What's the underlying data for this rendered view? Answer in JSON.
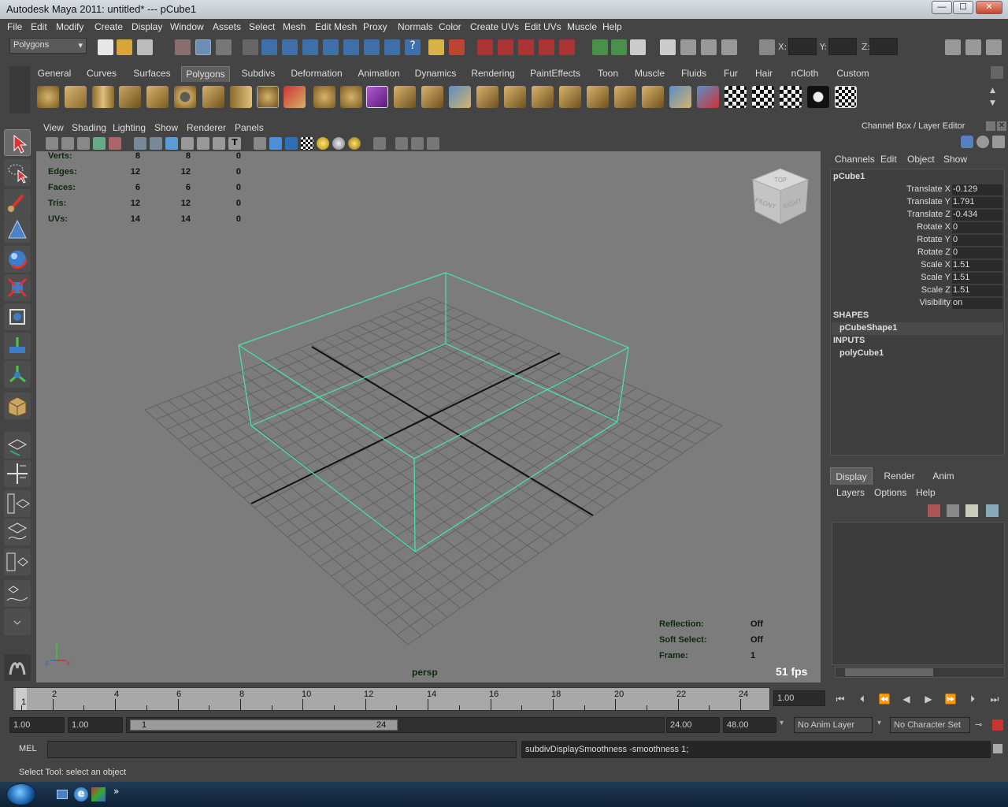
{
  "window": {
    "title": "Autodesk Maya 2011: untitled*  ---  pCube1",
    "min": "—",
    "max": "☐",
    "close": "✕"
  },
  "menubar": [
    "File",
    "Edit",
    "Modify",
    "Create",
    "Display",
    "Window",
    "Assets",
    "Select",
    "Mesh",
    "Edit Mesh",
    "Proxy",
    "Normals",
    "Color",
    "Create UVs",
    "Edit UVs",
    "Muscle",
    "Help"
  ],
  "statusline": {
    "menuset": "Polygons",
    "x_label": "X:",
    "y_label": "Y:",
    "z_label": "Z:"
  },
  "shelf": {
    "tabs": [
      "General",
      "Curves",
      "Surfaces",
      "Polygons",
      "Subdivs",
      "Deformation",
      "Animation",
      "Dynamics",
      "Rendering",
      "PaintEffects",
      "Toon",
      "Muscle",
      "Fluids",
      "Fur",
      "Hair",
      "nCloth",
      "Custom"
    ],
    "active_tab": "Polygons"
  },
  "viewport": {
    "menu": [
      "View",
      "Shading",
      "Lighting",
      "Show",
      "Renderer",
      "Panels"
    ],
    "hud": {
      "rows": [
        {
          "label": "Verts:",
          "a": "8",
          "b": "8",
          "c": "0"
        },
        {
          "label": "Edges:",
          "a": "12",
          "b": "12",
          "c": "0"
        },
        {
          "label": "Faces:",
          "a": "6",
          "b": "6",
          "c": "0"
        },
        {
          "label": "Tris:",
          "a": "12",
          "b": "12",
          "c": "0"
        },
        {
          "label": "UVs:",
          "a": "14",
          "b": "14",
          "c": "0"
        }
      ],
      "reflection_label": "Reflection:",
      "reflection": "Off",
      "softselect_label": "Soft Select:",
      "softselect": "Off",
      "frame_label": "Frame:",
      "frame": "1",
      "fps": "51 fps",
      "camera": "persp"
    },
    "viewcube": {
      "top": "TOP",
      "front": "FRONT",
      "right": "RIGHT"
    },
    "colors": {
      "bg": "#7c7c7c",
      "grid": "#626262",
      "axis": "#111111",
      "wire": "#46e8a4"
    }
  },
  "channelbox": {
    "header": "Channel Box / Layer Editor",
    "menu": [
      "Channels",
      "Edit",
      "Object",
      "Show"
    ],
    "object": "pCube1",
    "attrs": [
      {
        "name": "Translate X",
        "value": "-0.129"
      },
      {
        "name": "Translate Y",
        "value": "1.791"
      },
      {
        "name": "Translate Z",
        "value": "-0.434"
      },
      {
        "name": "Rotate X",
        "value": "0"
      },
      {
        "name": "Rotate Y",
        "value": "0"
      },
      {
        "name": "Rotate Z",
        "value": "0"
      },
      {
        "name": "Scale X",
        "value": "1.51"
      },
      {
        "name": "Scale Y",
        "value": "1.51"
      },
      {
        "name": "Scale Z",
        "value": "1.51"
      },
      {
        "name": "Visibility",
        "value": "on"
      }
    ],
    "shapes_label": "SHAPES",
    "shape": "pCubeShape1",
    "inputs_label": "INPUTS",
    "input": "polyCube1"
  },
  "layereditor": {
    "tabs": [
      "Display",
      "Render",
      "Anim"
    ],
    "active_tab": "Display",
    "menu": [
      "Layers",
      "Options",
      "Help"
    ]
  },
  "timeline": {
    "ticks": [
      "2",
      "4",
      "6",
      "8",
      "10",
      "12",
      "14",
      "16",
      "18",
      "20",
      "22",
      "24"
    ],
    "current": "1",
    "current_field": "1.00"
  },
  "range": {
    "start": "1.00",
    "playstart": "1.00",
    "slider_start": "1",
    "slider_end": "24",
    "playend": "24.00",
    "end": "48.00",
    "anim_layer": "No Anim Layer",
    "char_set": "No Character Set"
  },
  "cmdline": {
    "lang": "MEL",
    "result": "subdivDisplaySmoothness -smoothness 1;"
  },
  "helpline": "Select Tool: select an object"
}
